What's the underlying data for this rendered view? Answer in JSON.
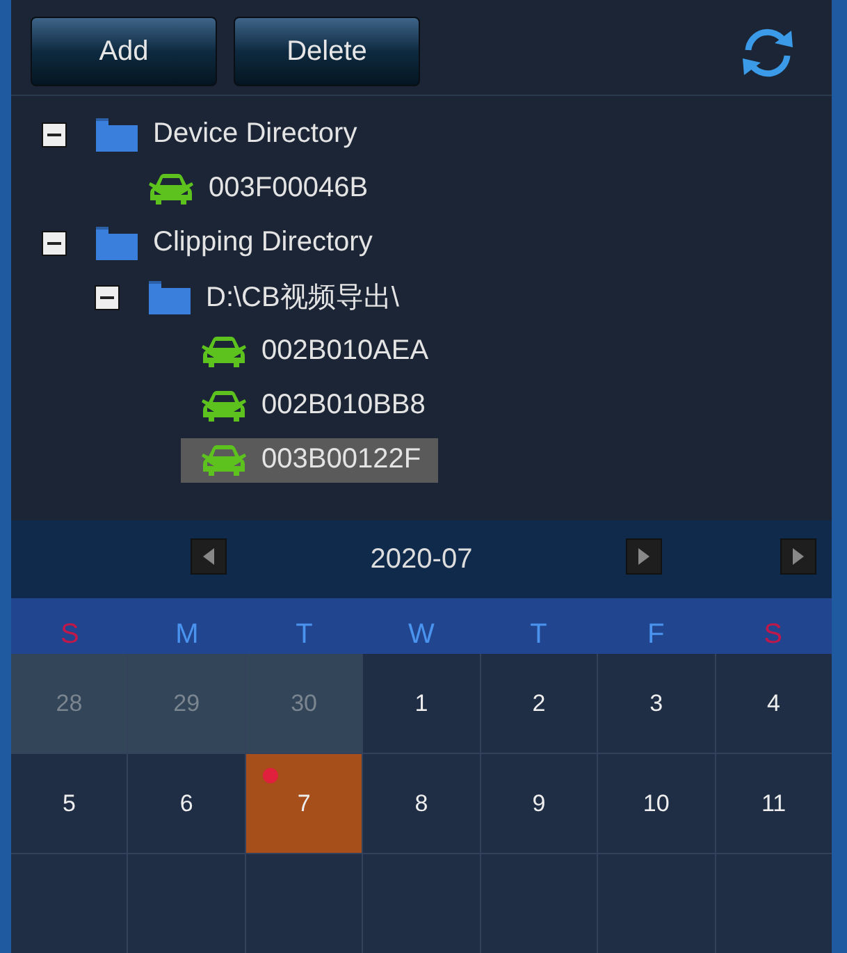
{
  "toolbar": {
    "buttons": [
      "Add",
      "Delete"
    ]
  },
  "tree": [
    {
      "label": "Device Directory",
      "kind": "folder",
      "expanded": true,
      "selected": false,
      "children": [
        {
          "label": "003F00046B",
          "kind": "device",
          "selected": false
        }
      ]
    },
    {
      "label": "Clipping Directory",
      "kind": "folder",
      "expanded": true,
      "selected": false,
      "children": [
        {
          "label": "D:\\CB视频导出\\",
          "kind": "folder",
          "expanded": true,
          "selected": false,
          "children": [
            {
              "label": "002B010AEA",
              "kind": "device",
              "selected": false
            },
            {
              "label": "002B010BB8",
              "kind": "device",
              "selected": false
            },
            {
              "label": "003B00122F",
              "kind": "device",
              "selected": true
            }
          ]
        }
      ]
    }
  ],
  "calendar": {
    "month": "2020-07",
    "weekdays": [
      {
        "label": "S",
        "weekend": true
      },
      {
        "label": "M",
        "weekend": false
      },
      {
        "label": "T",
        "weekend": false
      },
      {
        "label": "W",
        "weekend": false
      },
      {
        "label": "T",
        "weekend": false
      },
      {
        "label": "F",
        "weekend": false
      },
      {
        "label": "S",
        "weekend": true
      }
    ],
    "days": [
      {
        "label": "28",
        "in_month": false,
        "selected": false,
        "marked": false
      },
      {
        "label": "29",
        "in_month": false,
        "selected": false,
        "marked": false
      },
      {
        "label": "30",
        "in_month": false,
        "selected": false,
        "marked": false
      },
      {
        "label": "1",
        "in_month": true,
        "selected": false,
        "marked": false
      },
      {
        "label": "2",
        "in_month": true,
        "selected": false,
        "marked": false
      },
      {
        "label": "3",
        "in_month": true,
        "selected": false,
        "marked": false
      },
      {
        "label": "4",
        "in_month": true,
        "selected": false,
        "marked": false
      },
      {
        "label": "5",
        "in_month": true,
        "selected": false,
        "marked": false
      },
      {
        "label": "6",
        "in_month": true,
        "selected": false,
        "marked": false
      },
      {
        "label": "7",
        "in_month": true,
        "selected": true,
        "marked": true
      },
      {
        "label": "8",
        "in_month": true,
        "selected": false,
        "marked": false
      },
      {
        "label": "9",
        "in_month": true,
        "selected": false,
        "marked": false
      },
      {
        "label": "10",
        "in_month": true,
        "selected": false,
        "marked": false
      },
      {
        "label": "11",
        "in_month": true,
        "selected": false,
        "marked": false
      }
    ]
  }
}
